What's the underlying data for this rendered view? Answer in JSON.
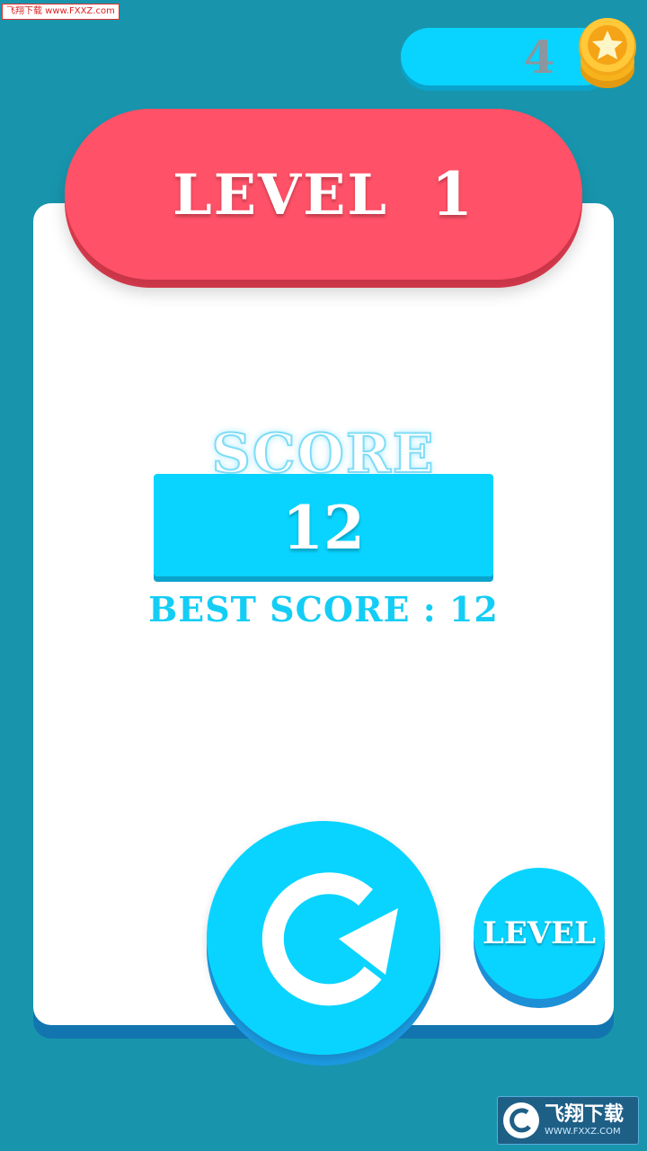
{
  "watermark_top": "飞翔下载 www.FXXZ.com",
  "coins": {
    "count": "4"
  },
  "level_banner": {
    "label": "LEVEL",
    "number": "1"
  },
  "score": {
    "title": "SCORE",
    "value": "12",
    "best": "BEST SCORE : 12"
  },
  "buttons": {
    "restart": "restart",
    "level_label": "LEVEL"
  },
  "watermark_bottom": {
    "brand": "飞翔下载",
    "url": "WWW.FXXZ.COM"
  },
  "colors": {
    "background": "#1895ad",
    "accent_cyan": "#09d4ff",
    "banner_red": "#ff5167",
    "best_score_text": "#14cdf5",
    "coin_gold": "#f7b41c"
  },
  "icons": [
    "coin-star-icon",
    "restart-arrow-icon",
    "fxxz-logo-icon"
  ]
}
